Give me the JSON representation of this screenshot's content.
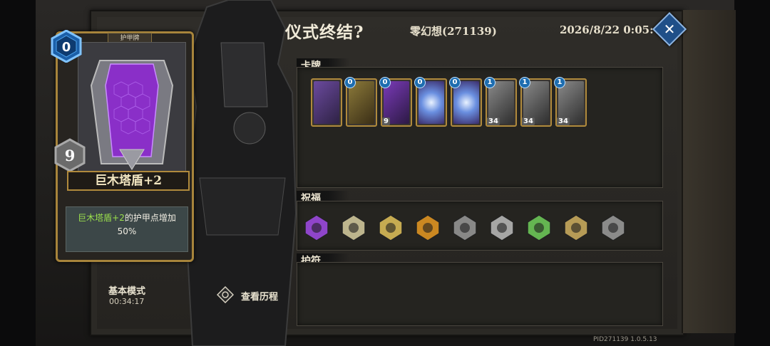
{
  "header": {
    "title": "仪式终结?",
    "player": "零幻想(271139)",
    "datetime": "2026/8/22 0:05:49",
    "close_icon": "close-icon"
  },
  "selected_card": {
    "type_tag": "护甲牌",
    "cost": "0",
    "number": "9",
    "name": "巨木塔盾+2",
    "description_prefix": "巨木塔盾+2",
    "description_suffix": "的护甲点增加",
    "description_value": "50%"
  },
  "sections": {
    "cards_label": "卡牌",
    "blessings_label": "祝福",
    "amulets_label": "护符"
  },
  "deck": [
    {
      "cost": "",
      "value": "",
      "icon": "scythe-card-icon"
    },
    {
      "cost": "0",
      "value": "",
      "icon": "warrior-card-icon"
    },
    {
      "cost": "0",
      "value": "9",
      "icon": "tower-shield-card-icon"
    },
    {
      "cost": "0",
      "value": "",
      "icon": "shield-card-icon"
    },
    {
      "cost": "0",
      "value": "",
      "icon": "shield-card-icon"
    },
    {
      "cost": "1",
      "value": "34",
      "icon": "armor-card-icon"
    },
    {
      "cost": "1",
      "value": "34",
      "icon": "armor-card-icon"
    },
    {
      "cost": "1",
      "value": "34",
      "icon": "armor-card-icon"
    }
  ],
  "blessings": [
    "purple-crystal-icon",
    "skeleton-icon",
    "golden-helm-icon",
    "flame-helm-icon",
    "warrior-bust-icon",
    "armor-chest-icon",
    "goggles-icon",
    "witch-icon",
    "shadow-figure-icon"
  ],
  "footer": {
    "mode": "基本模式",
    "mode_time": "00:34:17",
    "history_label": "查看历程",
    "pid": "PID271139  1.0.5.13"
  },
  "colors": {
    "gold": "#b08a3c",
    "cost_blue": "#1d6db0",
    "highlight_green": "#9be04c",
    "close_blue": "#1f4f88"
  }
}
